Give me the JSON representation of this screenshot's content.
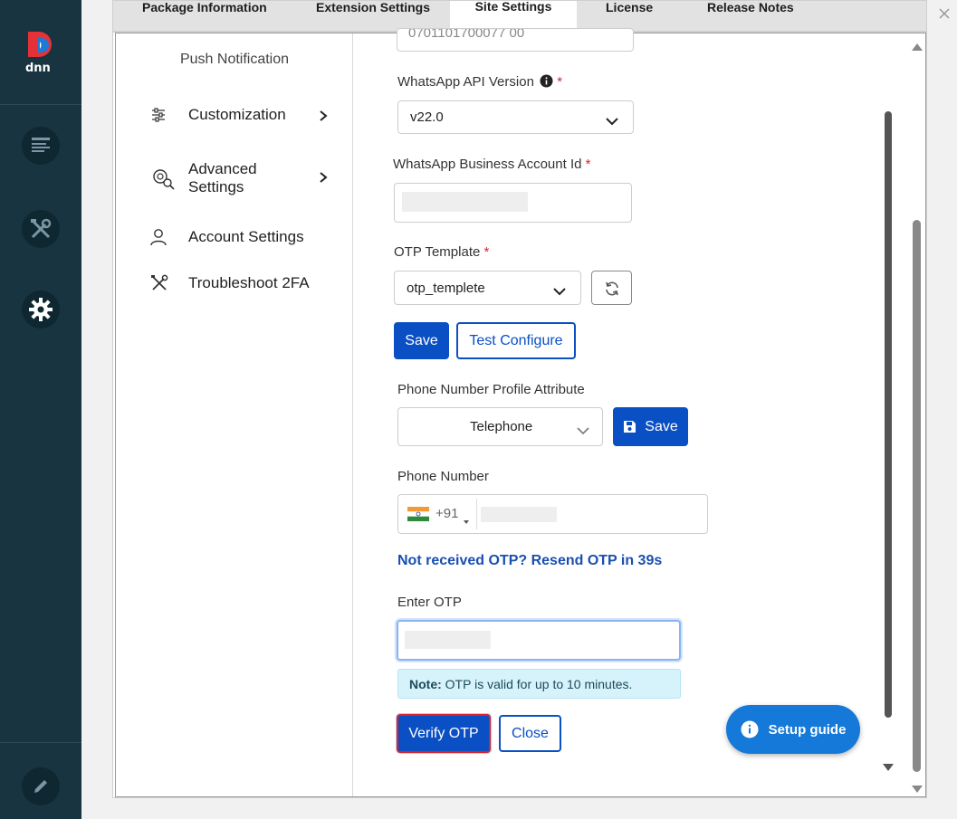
{
  "tabs": [
    "Package Information",
    "Extension Settings",
    "Site Settings",
    "License",
    "Release Notes"
  ],
  "nav": {
    "top_item": "Push Notification",
    "customization": "Customization",
    "advanced_line1": "Advanced",
    "advanced_line2": "Settings",
    "account": "Account Settings",
    "troubleshoot": "Troubleshoot 2FA"
  },
  "form": {
    "top_partial_value": "0701101700077 00",
    "api_version_label": "WhatsApp API Version",
    "api_version_value": "v22.0",
    "business_id_label": "WhatsApp Business Account Id",
    "otp_template_label": "OTP Template",
    "otp_template_value": "otp_templete",
    "save_label": "Save",
    "test_configure_label": "Test Configure",
    "phone_attr_label": "Phone Number Profile Attribute",
    "phone_attr_value": "Telephone",
    "phone_attr_save_label": "Save",
    "phone_number_label": "Phone Number",
    "country_code": "+91",
    "resend_text": "Not received OTP? Resend OTP in 39s",
    "enter_otp_label": "Enter OTP",
    "note_bold": "Note:",
    "note_text": "OTP is valid for up to 10 minutes.",
    "verify_label": "Verify OTP",
    "close_label": "Close",
    "required_mark": "*"
  },
  "setup_guide": "Setup guide",
  "colors": {
    "sidebar": "#183440",
    "primary": "#0a4fc4",
    "link": "#1a4fb0",
    "required": "#d9232d",
    "note_bg": "#d6f3fb",
    "setup_guide": "#1479d9"
  }
}
